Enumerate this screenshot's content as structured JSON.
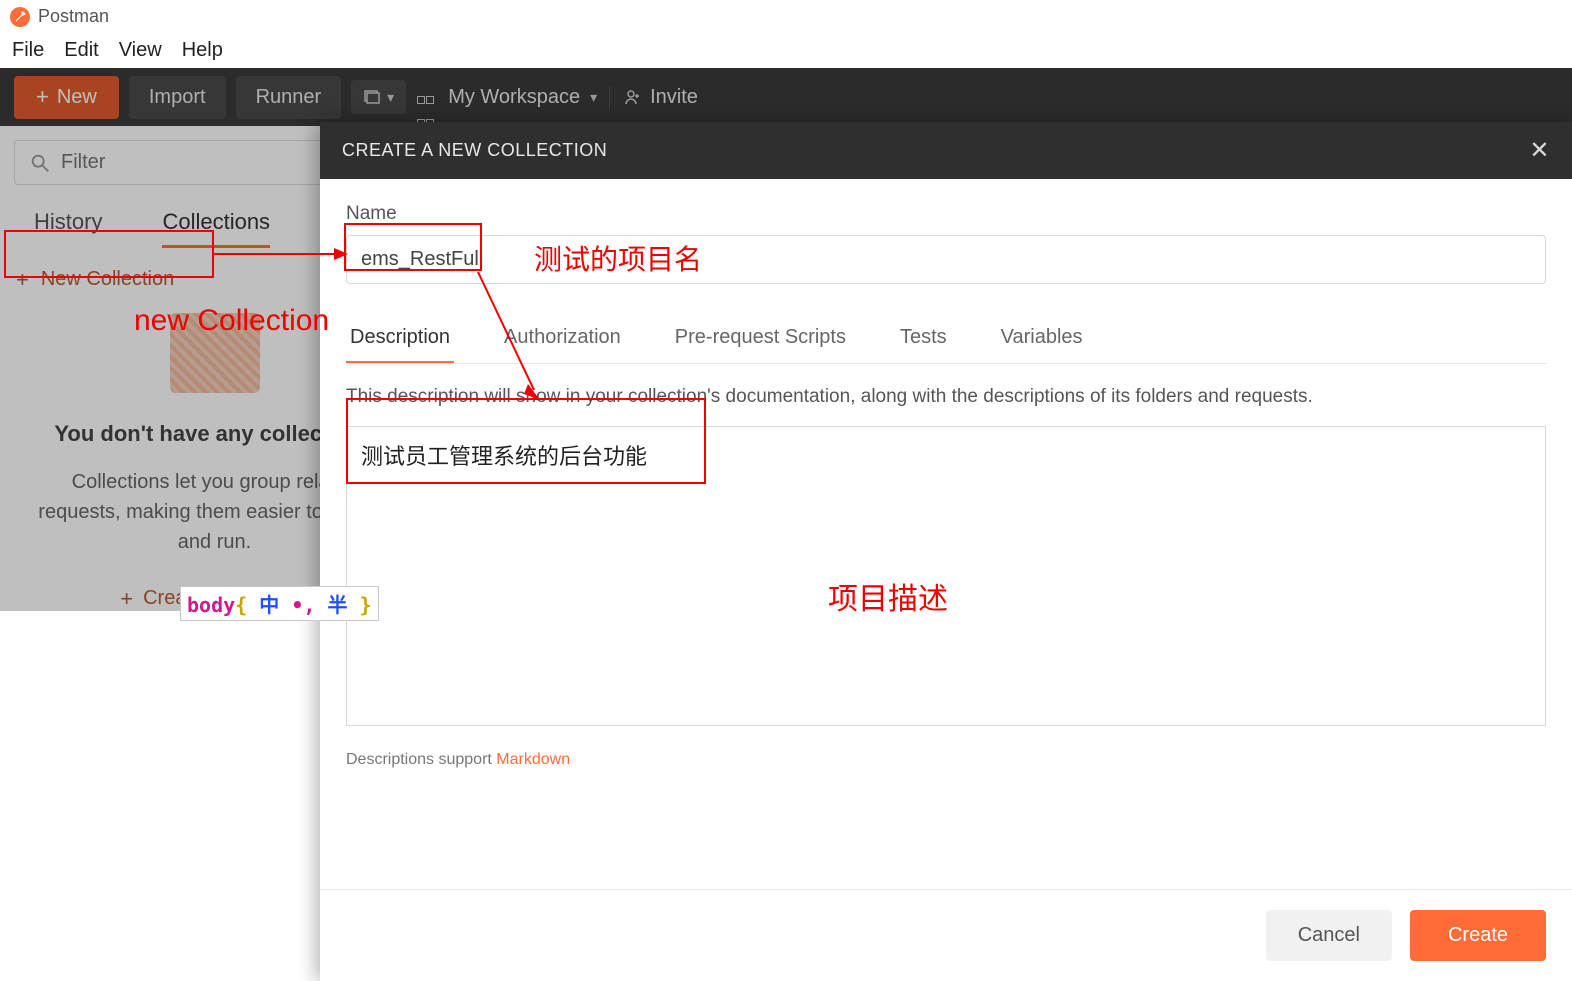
{
  "app": {
    "title": "Postman"
  },
  "menu": {
    "file": "File",
    "edit": "Edit",
    "view": "View",
    "help": "Help"
  },
  "toolbar": {
    "new_label": "New",
    "import_label": "Import",
    "runner_label": "Runner",
    "workspace_label": "My Workspace",
    "invite_label": "Invite"
  },
  "sidebar": {
    "filter_placeholder": "Filter",
    "tabs": {
      "history": "History",
      "collections": "Collections"
    },
    "new_collection_link": "New Collection",
    "empty": {
      "heading": "You don't have any collections",
      "text": "Collections let you group related requests, making them easier to access and run.",
      "create_link": "Create a collection"
    }
  },
  "modal": {
    "title": "CREATE A NEW COLLECTION",
    "name_label": "Name",
    "name_value": "ems_RestFul",
    "tabs": {
      "description": "Description",
      "authorization": "Authorization",
      "prerequest": "Pre-request Scripts",
      "tests": "Tests",
      "variables": "Variables"
    },
    "desc_hint": "This description will show in your collection's documentation, along with the descriptions of its folders and requests.",
    "desc_value": "测试员工管理系统的后台功能",
    "markdown_note_prefix": "Descriptions support ",
    "markdown_note_link": "Markdown",
    "cancel_label": "Cancel",
    "create_label": "Create"
  },
  "annotations": {
    "new_collection_text": "new Collection",
    "project_name_text": "测试的项目名",
    "project_desc_text": "项目描述"
  },
  "ime": {
    "body": "body",
    "mid": " 中 ",
    "dots": "•,",
    "half": " 半 "
  }
}
